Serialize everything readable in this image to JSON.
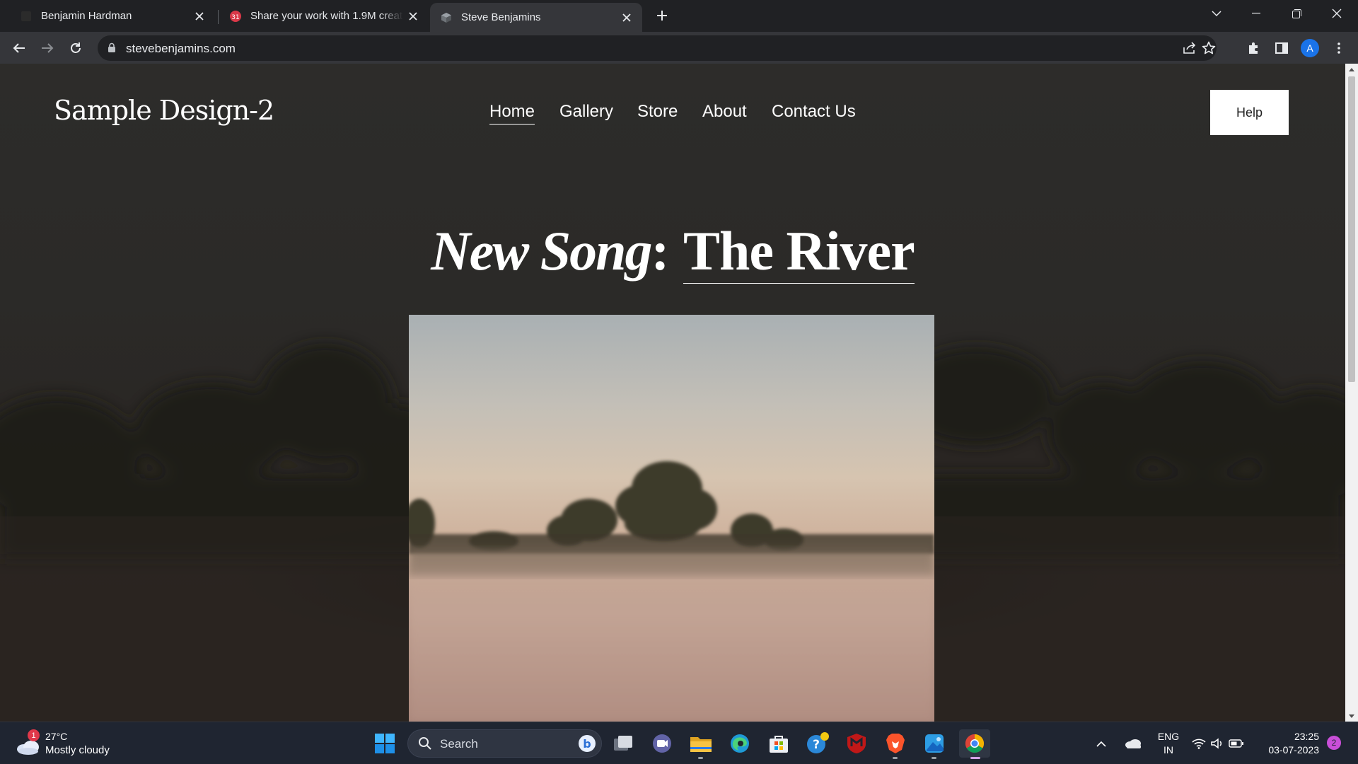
{
  "browser": {
    "tabs": [
      {
        "title": "Benjamin Hardman",
        "active": false
      },
      {
        "title": "Share your work with 1.9M creati",
        "active": false
      },
      {
        "title": "Steve Benjamins",
        "active": true
      }
    ],
    "address": "stevebenjamins.com",
    "profile_initial": "A"
  },
  "site": {
    "logo": "Sample Design-2",
    "nav": [
      {
        "label": "Home",
        "active": true
      },
      {
        "label": "Gallery",
        "active": false
      },
      {
        "label": "Store",
        "active": false
      },
      {
        "label": "About",
        "active": false
      },
      {
        "label": "Contact Us",
        "active": false
      }
    ],
    "help_button": "Help",
    "headline_prefix": "New Song",
    "headline_colon": ":",
    "headline_link": "The River"
  },
  "taskbar": {
    "weather_badge": "1",
    "weather_temp": "27°C",
    "weather_desc": "Mostly cloudy",
    "search_label": "Search",
    "lang_line1": "ENG",
    "lang_line2": "IN",
    "time": "23:25",
    "date": "03-07-2023",
    "notification_count": "2"
  }
}
